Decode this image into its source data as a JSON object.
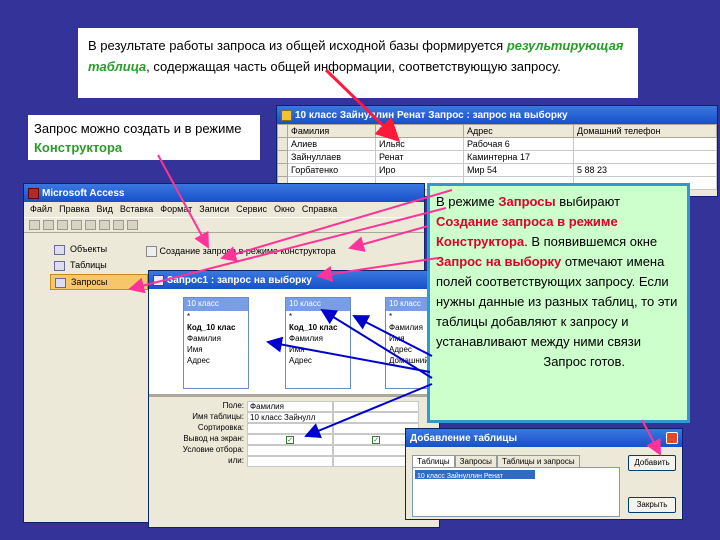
{
  "intro": {
    "part1": "В результате работы запроса из общей исходной базы формируется",
    "highlight": "результирующая таблица",
    "part2": ", содержащая часть общей информации, соответствующую запросу."
  },
  "left_note": {
    "part1": "Запрос можно создать и в режиме",
    "highlight": "Конструктора"
  },
  "table_window": {
    "title": "10 класс Зайнуллин Ренат Запрос : запрос на выборку",
    "columns": [
      "Фамилия",
      "Имя",
      "Адрес",
      "Домашний телефон"
    ],
    "rows": [
      [
        "Алиев",
        "Ильяс",
        "Рабочая 6",
        ""
      ],
      [
        "Зайнуллаев",
        "Ренат",
        "Каминтерна 17",
        ""
      ],
      [
        "Горбатенко",
        "Иро",
        "Мир 54",
        "5 88 23"
      ]
    ]
  },
  "access_window": {
    "title": "Microsoft Access",
    "menu": [
      "Файл",
      "Правка",
      "Вид",
      "Вставка",
      "Формат",
      "Записи",
      "Сервис",
      "Окно",
      "Справка"
    ],
    "objects": [
      "Объекты",
      "Таблицы",
      "Запросы"
    ],
    "create_item": "Создание запроса в режиме конструктора"
  },
  "query_window": {
    "title": "Запрос1 : запрос на выборку",
    "tables": [
      {
        "name": "10 класс",
        "fields": [
          "*",
          "Код_10 клас",
          "Фамилия",
          "Имя",
          "Адрес"
        ]
      },
      {
        "name": "10 класс",
        "fields": [
          "*",
          "Код_10 клас",
          "Фамилия",
          "Имя",
          "Адрес"
        ]
      },
      {
        "name": "10 класс",
        "fields": [
          "*",
          "Фамилия",
          "Имя",
          "Адрес",
          "Домашний"
        ]
      }
    ],
    "grid": [
      {
        "label": "Поле:",
        "value": "Фамилия"
      },
      {
        "label": "Имя таблицы:",
        "value": "10 класс Зайнулл"
      },
      {
        "label": "Сортировка:",
        "value": ""
      },
      {
        "label": "Вывод на экран:",
        "value": "✓"
      },
      {
        "label": "Условие отбора:",
        "value": ""
      },
      {
        "label": "или:",
        "value": ""
      }
    ]
  },
  "add_table_dialog": {
    "title": "Добавление таблицы",
    "tabs": [
      "Таблицы",
      "Запросы",
      "Таблицы и запросы"
    ],
    "selected_item": "10 класс Зайнуллин Ренат",
    "buttons": {
      "add": "Добавить",
      "close": "Закрыть"
    }
  },
  "callout": {
    "t1": "В режиме ",
    "r1": "Запросы",
    "t2": " выбирают ",
    "r2": "Создание запроса в режиме Конструктора",
    "t3": ". В появившемся окне ",
    "r3": "Запрос на выборку",
    "t4": " отмечают имена полей соответствующих запросу. Если нужны данные из разных таблиц, то эти таблицы добавляют к запросу и устанавливают между ними связи",
    "ready": "Запрос готов."
  },
  "colors": {
    "background": "#33339a",
    "highlight_green": "#2a9c2a",
    "accent_red": "#e0002a",
    "callout_bg": "#ccffcc",
    "callout_border": "#3399cc"
  }
}
